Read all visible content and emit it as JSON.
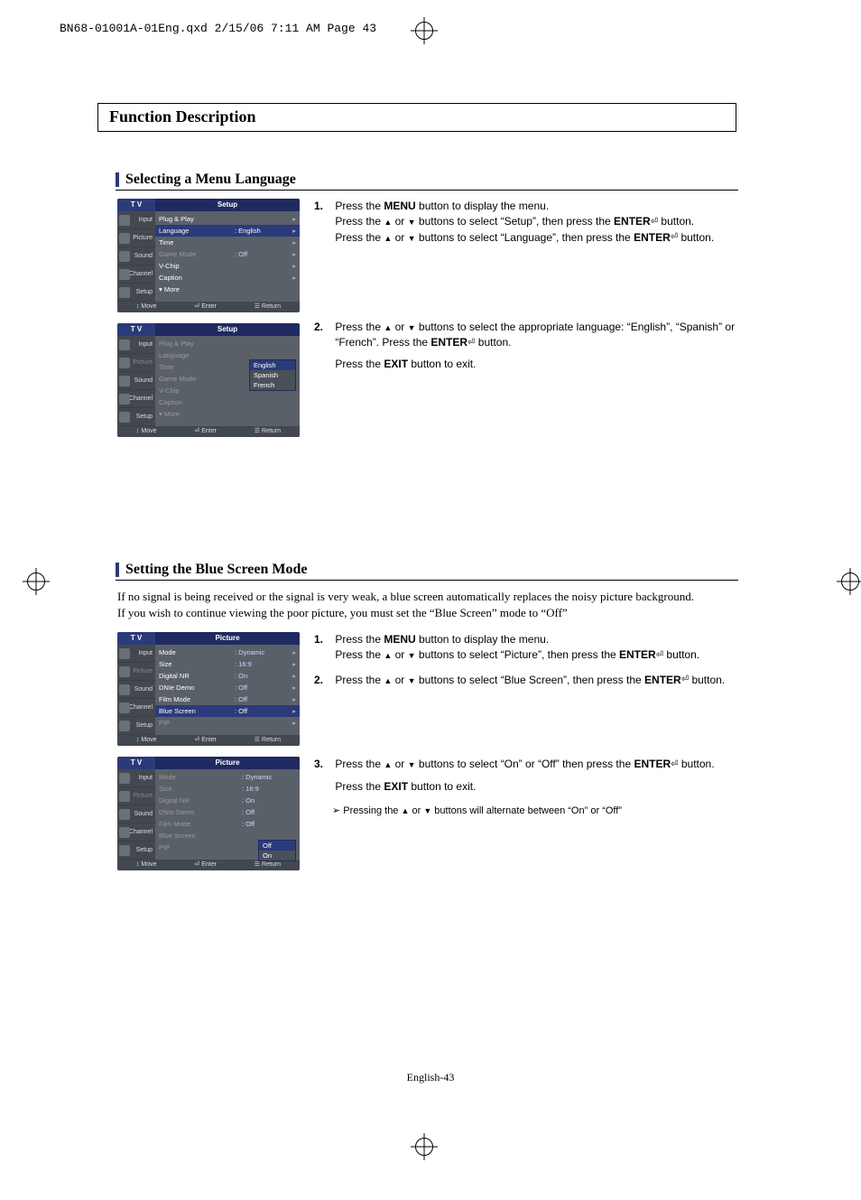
{
  "print_line": "BN68-01001A-01Eng.qxd  2/15/06  7:11 AM  Page 43",
  "page_title": "Function Description",
  "section1": {
    "heading": "Selecting a Menu Language",
    "step1": {
      "num": "1.",
      "l1a": "Press the ",
      "l1b": "MENU",
      "l1c": " button to display the menu.",
      "l2a": "Press the ",
      "l2b": " or ",
      "l2c": " buttons to select “Setup”, then press the ",
      "l2d": "ENTER",
      "l2e": " button.",
      "l3a": "Press the ",
      "l3b": " or ",
      "l3c": " buttons to select “Language”, then press the ",
      "l3d": "ENTER",
      "l3e": " button."
    },
    "step2": {
      "num": "2.",
      "l1a": "Press the ",
      "l1b": " or ",
      "l1c": " buttons to select the appropriate language: “English”, “Spanish” or “French”. Press the ",
      "l1d": "ENTER",
      "l1e": " button.",
      "l2a": "Press the ",
      "l2b": "EXIT",
      "l2c": " button to exit."
    }
  },
  "section2": {
    "heading": "Setting the Blue Screen Mode",
    "intro1": "If no signal is being received or the signal is very weak, a blue screen automatically replaces the noisy picture background.",
    "intro2": "If you wish to continue viewing the poor picture, you must set the “Blue Screen” mode to “Off”",
    "step1": {
      "num": "1.",
      "l1a": "Press the ",
      "l1b": "MENU",
      "l1c": " button to display the menu.",
      "l2a": "Press the ",
      "l2b": " or ",
      "l2c": " buttons to select “Picture”, then press the ",
      "l2d": "ENTER",
      "l2e": " button."
    },
    "step2": {
      "num": "2.",
      "l1a": "Press the ",
      "l1b": " or ",
      "l1c": " buttons to select “Blue Screen”, then press the ",
      "l1d": "ENTER",
      "l1e": " button."
    },
    "step3": {
      "num": "3.",
      "l1a": "Press the ",
      "l1b": " or ",
      "l1c": " buttons to select “On” or “Off” then press the ",
      "l1d": "ENTER",
      "l1e": " button.",
      "l2a": "Press the ",
      "l2b": "EXIT",
      "l2c": " button to exit.",
      "note_a": "Pressing the ",
      "note_b": " or ",
      "note_c": "  buttons will alternate between “On” or “Off”"
    }
  },
  "osd": {
    "tv": "T V",
    "tabs": {
      "input": "Input",
      "picture": "Picture",
      "sound": "Sound",
      "channel": "Channel",
      "setup": "Setup"
    },
    "setup_title": "Setup",
    "picture_title": "Picture",
    "foot": {
      "move": "Move",
      "enter": "Enter",
      "return": "Return"
    },
    "setup_items": {
      "plug": "Plug & Play",
      "language": "Language",
      "language_v": ": English",
      "time": "Time",
      "game": "Game Mode",
      "game_v": ": Off",
      "vchip": "V-Chip",
      "caption": "Caption",
      "more": "More"
    },
    "lang_opts": {
      "en": "English",
      "es": "Spanish",
      "fr": "French"
    },
    "picture_items": {
      "mode": "Mode",
      "mode_v": ": Dynamic",
      "size": "Size",
      "size_v": ": 16:9",
      "dnr": "Digital NR",
      "dnr_v": ": On",
      "dnie": "DNIe Demo",
      "dnie_v": ": Off",
      "film": "Film Mode",
      "film_v": ": Off",
      "blue": "Blue Screen",
      "blue_v": ": Off",
      "pip": "PIP"
    },
    "blue_opts": {
      "off": "Off",
      "on": "On"
    }
  },
  "footer": "English-43",
  "glyph": {
    "up": "▲",
    "down": "▼",
    "updown": "↕",
    "enter": "⏎",
    "menu": "☰",
    "note_arrow": "➢"
  }
}
